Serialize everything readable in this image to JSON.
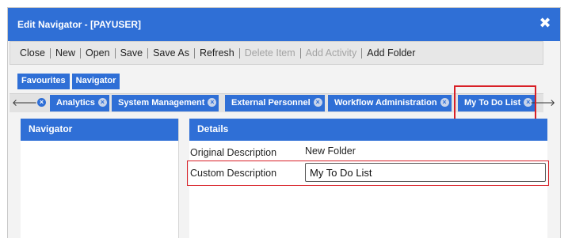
{
  "window": {
    "title": "Edit Navigator - [PAYUSER]",
    "close_glyph": "✖"
  },
  "toolbar": {
    "items": [
      {
        "label": "Close",
        "enabled": true
      },
      {
        "label": "New",
        "enabled": true
      },
      {
        "label": "Open",
        "enabled": true
      },
      {
        "label": "Save",
        "enabled": true
      },
      {
        "label": "Save As",
        "enabled": true
      },
      {
        "label": "Refresh",
        "enabled": true
      },
      {
        "label": "Delete Item",
        "enabled": false
      },
      {
        "label": "Add Activity",
        "enabled": false
      },
      {
        "label": "Add Folder",
        "enabled": true
      }
    ]
  },
  "top_tabs": [
    "Favourites",
    "Navigator"
  ],
  "nav_tabs": {
    "scroll_left_glyph": "🡐",
    "scroll_right_glyph": "🡒",
    "close_glyph": "×",
    "items": [
      {
        "label": "Analytics"
      },
      {
        "label": "System Management"
      },
      {
        "label": "External Personnel"
      },
      {
        "label": "Workflow Administration"
      },
      {
        "label": "My To Do List",
        "active": true
      }
    ]
  },
  "navigator_panel": {
    "header": "Navigator"
  },
  "details_panel": {
    "header": "Details",
    "original_description_label": "Original Description",
    "original_description_value": "New Folder",
    "custom_description_label": "Custom Description",
    "custom_description_value": "My To Do List"
  },
  "colors": {
    "accent": "#2f6fd6",
    "highlight": "#d81f26"
  }
}
